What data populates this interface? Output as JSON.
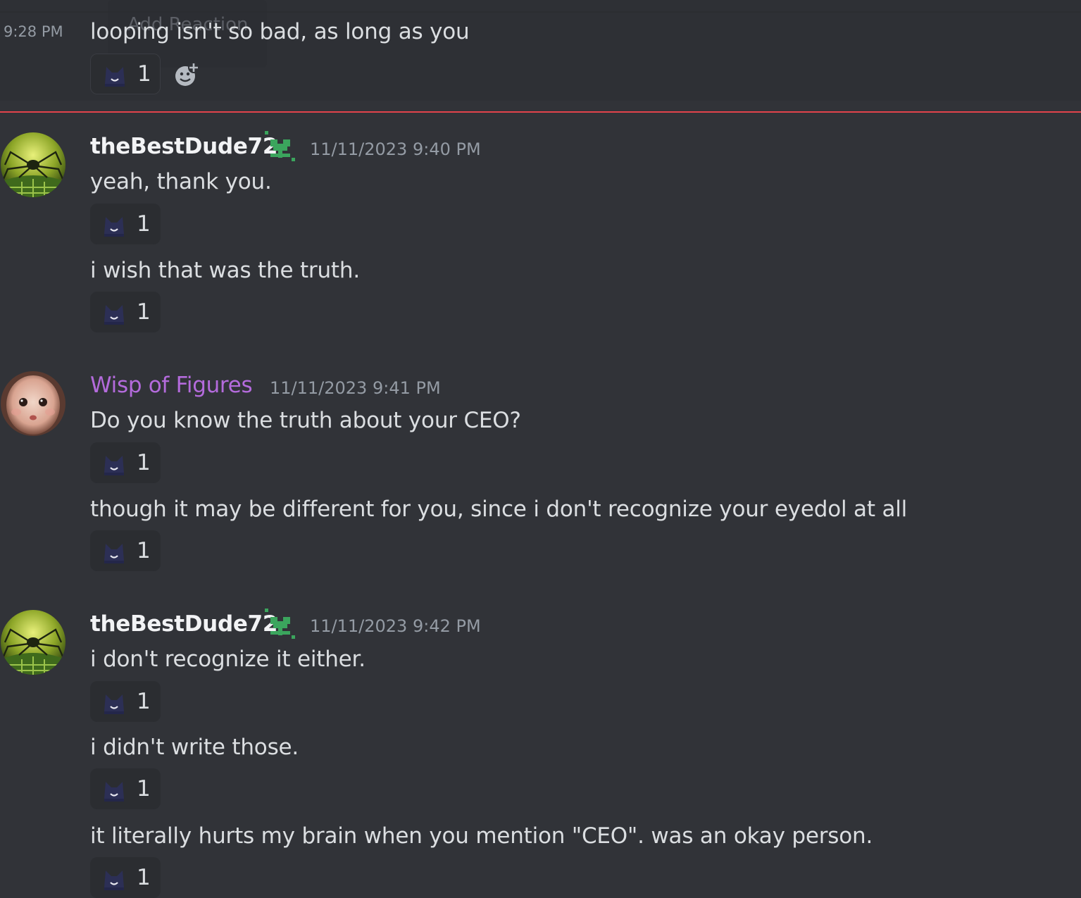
{
  "top_message": {
    "time": "9:28 PM",
    "text": "looping isn't so bad, as long as you",
    "tooltip": "Add Reaction",
    "reaction_count": "1"
  },
  "groups": [
    {
      "username": "theBestDude72",
      "timestamp": "11/11/2023 9:40 PM",
      "messages": [
        {
          "text": "yeah, thank you.",
          "reaction_count": "1"
        },
        {
          "text": "i wish that was the truth.",
          "reaction_count": "1"
        }
      ]
    },
    {
      "username": "Wisp of Figures",
      "timestamp": "11/11/2023 9:41 PM",
      "messages": [
        {
          "text": "Do you know the truth about your CEO?",
          "reaction_count": "1"
        },
        {
          "text": "though it may be different for you, since i don't recognize your eyedol at all",
          "reaction_count": "1"
        }
      ]
    },
    {
      "username": "theBestDude72",
      "timestamp": "11/11/2023 9:42 PM",
      "messages": [
        {
          "text": "i don't recognize it either.",
          "reaction_count": "1"
        },
        {
          "text": "i didn't write those.",
          "reaction_count": "1"
        },
        {
          "text": "it literally hurts my brain when you mention \"CEO\". was an okay person.",
          "reaction_count": "1"
        }
      ]
    }
  ],
  "icons": {
    "reaction_emoji": "cat-smile-emoji-icon",
    "add_reaction": "add-reaction-icon",
    "badge": "pixel-heart-sprout-icon"
  },
  "colors": {
    "background": "#313338",
    "new_messages_divider": "#e3434b",
    "wisp_name": "#b46bdc",
    "badge_green": "#3ba55d"
  }
}
